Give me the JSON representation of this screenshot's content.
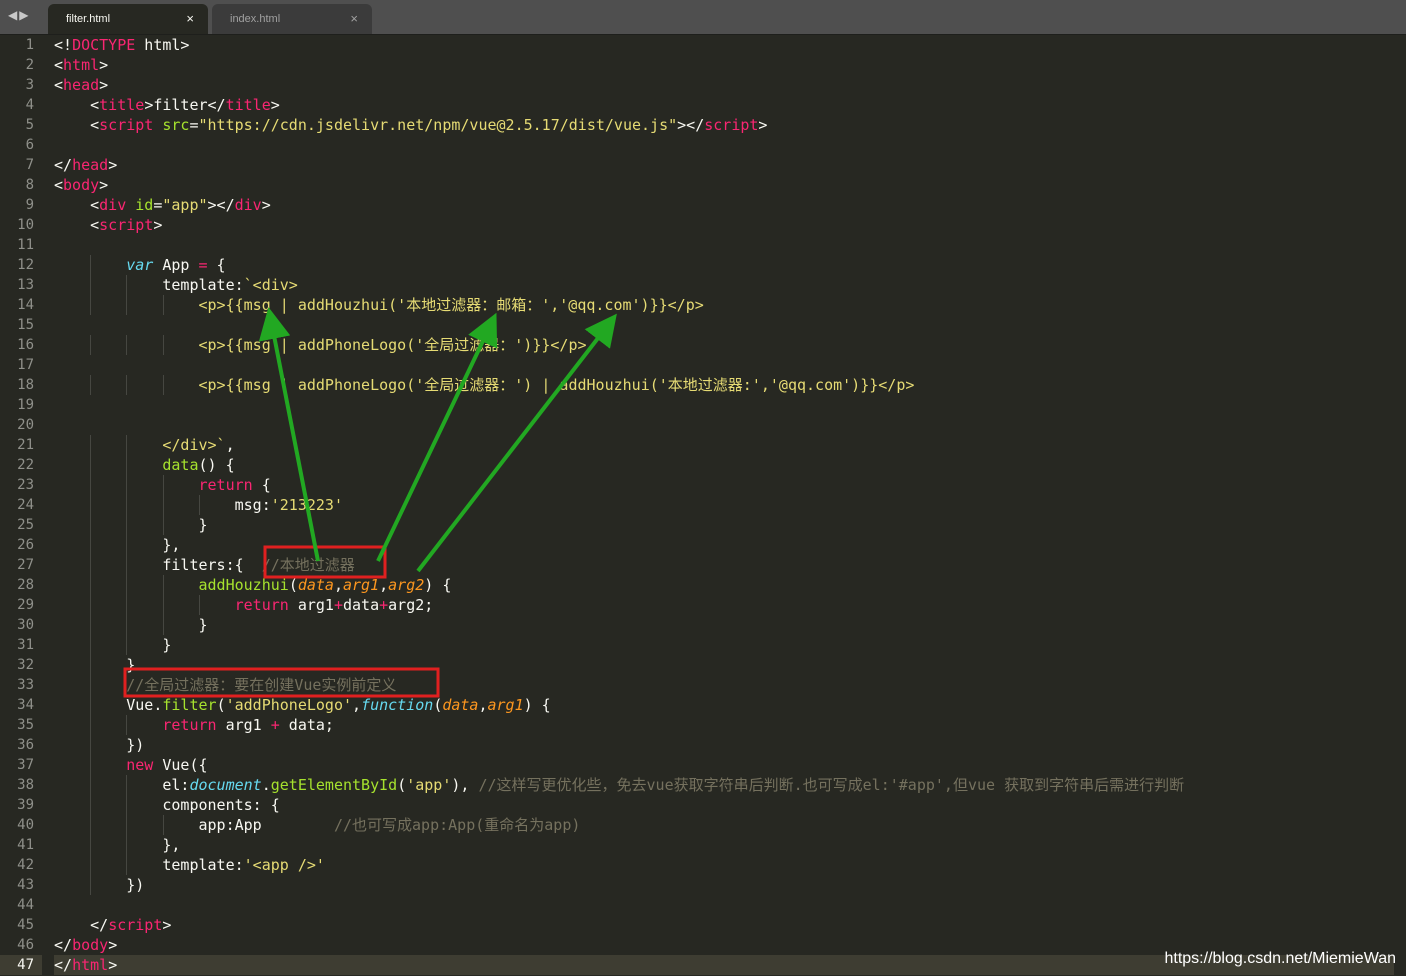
{
  "tabs": {
    "active": {
      "label": "filter.html",
      "close": "×"
    },
    "inactive": {
      "label": "index.html",
      "close": "×"
    }
  },
  "editor": {
    "current_line": 47,
    "lines": [
      [
        [
          "w",
          "<!"
        ],
        [
          "k",
          "DOCTYPE"
        ],
        [
          "w",
          " html>"
        ]
      ],
      [
        [
          "w",
          "<"
        ],
        [
          "t",
          "html"
        ],
        [
          "w",
          ">"
        ]
      ],
      [
        [
          "w",
          "<"
        ],
        [
          "t",
          "head"
        ],
        [
          "w",
          ">"
        ]
      ],
      [
        [
          "w",
          "    <"
        ],
        [
          "t",
          "title"
        ],
        [
          "w",
          ">filter</"
        ],
        [
          "t",
          "title"
        ],
        [
          "w",
          ">"
        ]
      ],
      [
        [
          "w",
          "    <"
        ],
        [
          "t",
          "script"
        ],
        [
          "w",
          " "
        ],
        [
          "a",
          "src"
        ],
        [
          "w",
          "="
        ],
        [
          "s",
          "\"https://cdn.jsdelivr.net/npm/vue@2.5.17/dist/vue.js\""
        ],
        [
          "w",
          "></"
        ],
        [
          "t",
          "script"
        ],
        [
          "w",
          ">"
        ]
      ],
      [],
      [
        [
          "w",
          "</"
        ],
        [
          "t",
          "head"
        ],
        [
          "w",
          ">"
        ]
      ],
      [
        [
          "w",
          "<"
        ],
        [
          "t",
          "body"
        ],
        [
          "w",
          ">"
        ]
      ],
      [
        [
          "w",
          "    <"
        ],
        [
          "t",
          "div"
        ],
        [
          "w",
          " "
        ],
        [
          "a",
          "id"
        ],
        [
          "w",
          "="
        ],
        [
          "s",
          "\"app\""
        ],
        [
          "w",
          "></"
        ],
        [
          "t",
          "div"
        ],
        [
          "w",
          ">"
        ]
      ],
      [
        [
          "w",
          "    <"
        ],
        [
          "t",
          "script"
        ],
        [
          "w",
          ">"
        ]
      ],
      [],
      [
        [
          "w",
          "        "
        ],
        [
          "st",
          "var"
        ],
        [
          "w",
          " App "
        ],
        [
          "k",
          "="
        ],
        [
          "w",
          " {"
        ]
      ],
      [
        [
          "w",
          "            template:"
        ],
        [
          "s",
          "`<div>"
        ]
      ],
      [
        [
          "w",
          "                "
        ],
        [
          "s",
          "<p>{{msg | addHouzhui('本地过滤器：邮箱：','@qq.com')}}</p>"
        ]
      ],
      [],
      [
        [
          "w",
          "                "
        ],
        [
          "s",
          "<p>{{msg | addPhoneLogo('全局过滤器：')}}</p>"
        ]
      ],
      [],
      [
        [
          "w",
          "                "
        ],
        [
          "s",
          "<p>{{msg | addPhoneLogo('全局过滤器：') | addHouzhui('本地过滤器:','@qq.com')}}</p>"
        ]
      ],
      [],
      [],
      [
        [
          "w",
          "            "
        ],
        [
          "s",
          "</div>`"
        ],
        [
          "w",
          ","
        ]
      ],
      [
        [
          "w",
          "            "
        ],
        [
          "fn",
          "data"
        ],
        [
          "w",
          "() {"
        ]
      ],
      [
        [
          "w",
          "                "
        ],
        [
          "k",
          "return"
        ],
        [
          "w",
          " {"
        ]
      ],
      [
        [
          "w",
          "                    msg:"
        ],
        [
          "s",
          "'213223'"
        ]
      ],
      [
        [
          "w",
          "                }"
        ]
      ],
      [
        [
          "w",
          "            },"
        ]
      ],
      [
        [
          "w",
          "            filters:{  "
        ],
        [
          "c",
          "//本地过滤器"
        ]
      ],
      [
        [
          "w",
          "                "
        ],
        [
          "fn",
          "addHouzhui"
        ],
        [
          "w",
          "("
        ],
        [
          "p",
          "data"
        ],
        [
          "w",
          ","
        ],
        [
          "p",
          "arg1"
        ],
        [
          "w",
          ","
        ],
        [
          "p",
          "arg2"
        ],
        [
          "w",
          ") {"
        ]
      ],
      [
        [
          "w",
          "                    "
        ],
        [
          "k",
          "return"
        ],
        [
          "w",
          " arg1"
        ],
        [
          "k",
          "+"
        ],
        [
          "w",
          "data"
        ],
        [
          "k",
          "+"
        ],
        [
          "w",
          "arg2;"
        ]
      ],
      [
        [
          "w",
          "                }"
        ]
      ],
      [
        [
          "w",
          "            }"
        ]
      ],
      [
        [
          "w",
          "        }"
        ]
      ],
      [
        [
          "w",
          "        "
        ],
        [
          "c",
          "//全局过滤器：要在创建Vue实例前定义"
        ]
      ],
      [
        [
          "w",
          "        Vue."
        ],
        [
          "fn",
          "filter"
        ],
        [
          "w",
          "("
        ],
        [
          "s",
          "'addPhoneLogo'"
        ],
        [
          "w",
          ","
        ],
        [
          "st",
          "function"
        ],
        [
          "w",
          "("
        ],
        [
          "p",
          "data"
        ],
        [
          "w",
          ","
        ],
        [
          "p",
          "arg1"
        ],
        [
          "w",
          ") {"
        ]
      ],
      [
        [
          "w",
          "            "
        ],
        [
          "k",
          "return"
        ],
        [
          "w",
          " arg1 "
        ],
        [
          "k",
          "+"
        ],
        [
          "w",
          " data;"
        ]
      ],
      [
        [
          "w",
          "        })"
        ]
      ],
      [
        [
          "w",
          "        "
        ],
        [
          "k",
          "new"
        ],
        [
          "w",
          " Vue({"
        ]
      ],
      [
        [
          "w",
          "            el:"
        ],
        [
          "st",
          "document"
        ],
        [
          "w",
          "."
        ],
        [
          "fn",
          "getElementById"
        ],
        [
          "w",
          "("
        ],
        [
          "s",
          "'app'"
        ],
        [
          "w",
          "), "
        ],
        [
          "c",
          "//这样写更优化些，免去vue获取字符串后判断.也可写成el:'#app',但vue 获取到字符串后需进行判断"
        ]
      ],
      [
        [
          "w",
          "            components: {"
        ]
      ],
      [
        [
          "w",
          "                app:App        "
        ],
        [
          "c",
          "//也可写成app:App(重命名为app)"
        ]
      ],
      [
        [
          "w",
          "            },"
        ]
      ],
      [
        [
          "w",
          "            template:"
        ],
        [
          "s",
          "'<app />'"
        ]
      ],
      [
        [
          "w",
          "        })"
        ]
      ],
      [],
      [
        [
          "w",
          "    </"
        ],
        [
          "t",
          "script"
        ],
        [
          "w",
          ">"
        ]
      ],
      [
        [
          "w",
          "</"
        ],
        [
          "t",
          "body"
        ],
        [
          "w",
          ">"
        ]
      ],
      [
        [
          "w",
          "</"
        ],
        [
          "t",
          "html"
        ],
        [
          "w",
          ">"
        ]
      ]
    ]
  },
  "annotations": {
    "arrow_color": "#22a822",
    "box_color": "#e02020"
  },
  "watermark": "https://blog.csdn.net/MiemieWan"
}
